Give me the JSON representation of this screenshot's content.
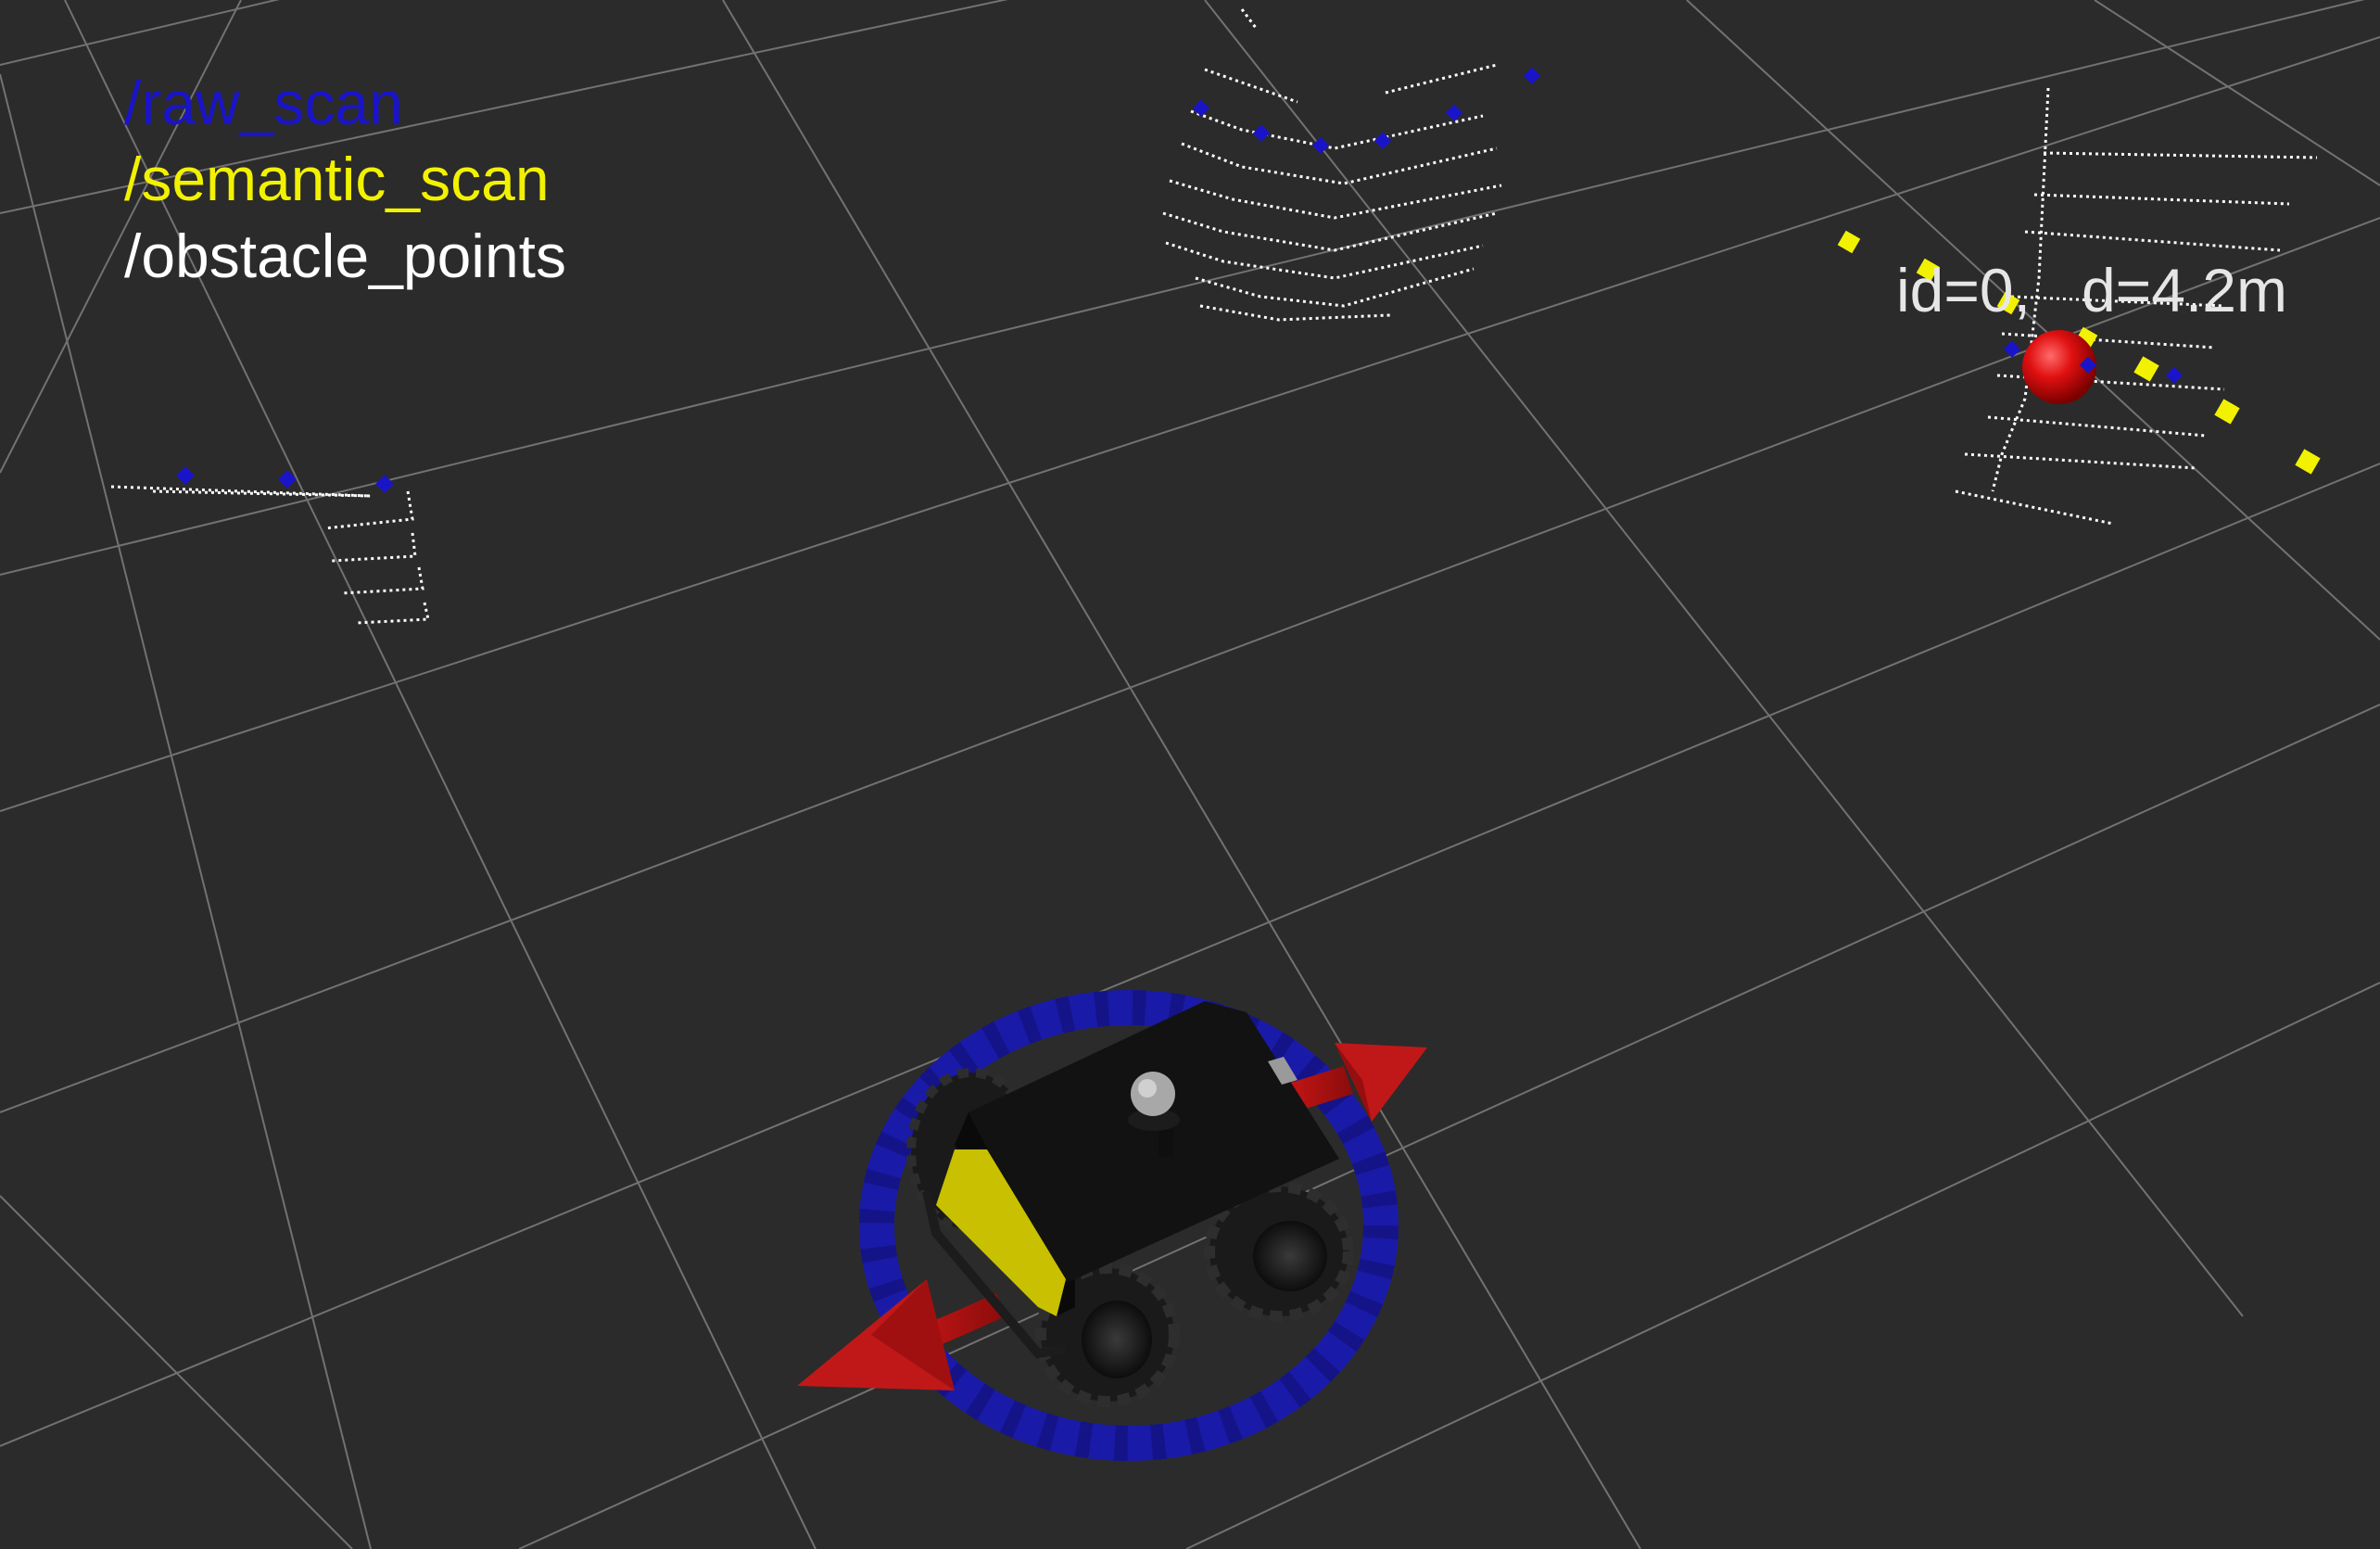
{
  "legend": {
    "raw_scan": {
      "label": "/raw_scan",
      "color": "#1a14c8"
    },
    "semantic_scan": {
      "label": "/semantic_scan",
      "color": "#f2f200"
    },
    "obstacle_points": {
      "label": "/obstacle_points",
      "color": "#ffffff"
    }
  },
  "marker": {
    "text": "id=0,   d=4.2m",
    "color": "#e01010"
  },
  "colors": {
    "background": "#2b2b2b",
    "grid": "#8a8a8a",
    "raw_scan": "#1a14c8",
    "semantic_scan": "#f2f200",
    "obstacle_points": "#ffffff",
    "robot_body": "#121212",
    "robot_plate": "#c8c000",
    "footprint_ring": "#1a1aa8",
    "axis_arrow": "#c01818"
  }
}
